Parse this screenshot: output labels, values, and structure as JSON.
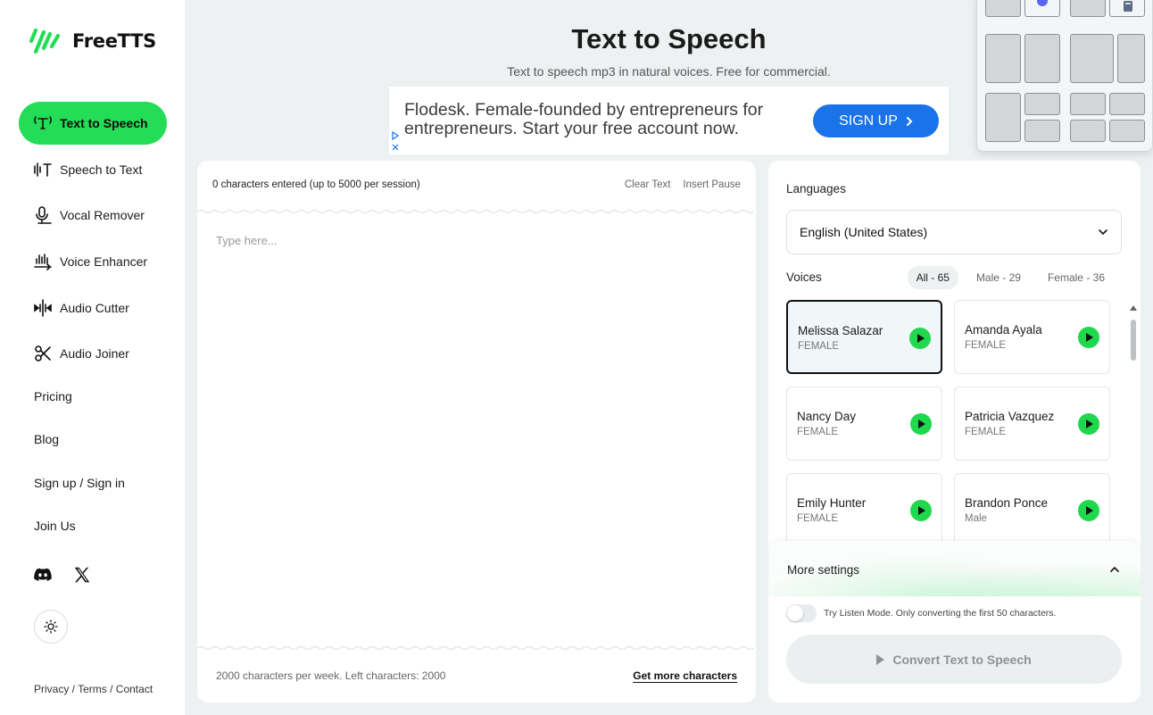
{
  "brand": {
    "name": "FreeTTS"
  },
  "sidebar": {
    "nav": [
      {
        "label": "Text to Speech",
        "icon": "text-to-speech-icon"
      },
      {
        "label": "Speech to Text",
        "icon": "speech-to-text-icon"
      },
      {
        "label": "Vocal Remover",
        "icon": "microphone-icon"
      },
      {
        "label": "Voice Enhancer",
        "icon": "voice-enhancer-icon"
      },
      {
        "label": "Audio Cutter",
        "icon": "audio-cutter-icon"
      },
      {
        "label": "Audio Joiner",
        "icon": "scissors-icon"
      }
    ],
    "links": [
      "Pricing",
      "Blog",
      "Sign up / Sign in",
      "Join Us"
    ],
    "footer": "Privacy / Terms / Contact"
  },
  "header": {
    "title": "Text to Speech",
    "subtitle": "Text to speech mp3 in natural voices. Free for commercial."
  },
  "ad": {
    "text": "Flodesk. Female-founded by entrepreneurs for entrepreneurs. Start your free account now.",
    "cta": "SIGN UP"
  },
  "editor": {
    "counter": "0 characters entered (up to 5000 per session)",
    "clear": "Clear Text",
    "insert_pause": "Insert Pause",
    "placeholder": "Type here...",
    "quota": "2000 characters per week. Left characters: 2000",
    "get_more": "Get more characters"
  },
  "settings": {
    "languages_label": "Languages",
    "language_value": "English (United States)",
    "voices_label": "Voices",
    "filters": [
      "All - 65",
      "Male - 29",
      "Female - 36"
    ],
    "voices": [
      {
        "name": "Melissa Salazar",
        "gender": "FEMALE"
      },
      {
        "name": "Amanda Ayala",
        "gender": "FEMALE"
      },
      {
        "name": "Nancy Day",
        "gender": "FEMALE"
      },
      {
        "name": "Patricia Vazquez",
        "gender": "FEMALE"
      },
      {
        "name": "Emily Hunter",
        "gender": "FEMALE"
      },
      {
        "name": "Brandon Ponce",
        "gender": "Male"
      }
    ],
    "more_settings": "More settings",
    "listen_mode": "Try Listen Mode. Only converting the first 50 characters.",
    "convert": "Convert Text to Speech"
  },
  "colors": {
    "accent": "#22dd55",
    "ad_button": "#1a73e8"
  }
}
